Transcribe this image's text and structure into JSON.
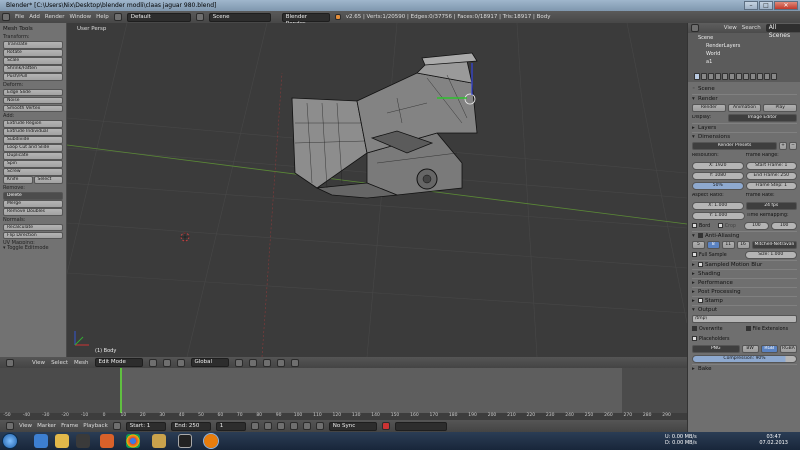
{
  "window": {
    "title": "Blender* [C:\\Users\\Nix\\Desktop\\blender modli\\claas jaguar 980.blend]",
    "minimize": "–",
    "maximize": "□",
    "close": "✕"
  },
  "infobar": {
    "menus": [
      "File",
      "Add",
      "Render",
      "Window",
      "Help"
    ],
    "screen_layout": "Default",
    "scene": "Scene",
    "engine": "Blender Render",
    "stats": "v2.65 | Verts:1/20590 | Edges:0/37756 | Faces:0/18917 | Tris:18917 | Body"
  },
  "toolpanel": {
    "title": "Mesh Tools",
    "sections": [
      {
        "label": "Transform:",
        "buttons": [
          "Translate",
          "Rotate",
          "Scale",
          "Shrink/Fatten",
          "Push/Pull"
        ]
      },
      {
        "label": "Deform:",
        "buttons": [
          "Edge Slide",
          "Noise",
          "Smooth Vertex"
        ]
      },
      {
        "label": "Add:",
        "buttons": [
          "Extrude Region",
          "Extrude Individual",
          "Subdivide",
          "Loop Cut and Slide",
          "Duplicate",
          "Spin",
          "Screw"
        ]
      }
    ],
    "knife_select": [
      "Knife",
      "Select"
    ],
    "remove_label": "Remove:",
    "remove_buttons": [
      "Delete",
      "Merge",
      "Remove Doubles"
    ],
    "normals_label": "Normals:",
    "normals_buttons": [
      "Recalculate",
      "Flip Direction"
    ],
    "uv_label": "UV Mapping:",
    "toggle_editmode": "Toggle Editmode"
  },
  "viewport": {
    "view_name": "User Persp",
    "object_label": "(1) Body"
  },
  "viewheader": {
    "items": [
      "View",
      "Select",
      "Mesh"
    ],
    "mode": "Edit Mode",
    "orientation": "Global"
  },
  "timeline": {
    "ticks": [
      "-50",
      "-40",
      "-30",
      "-20",
      "-10",
      "0",
      "10",
      "20",
      "30",
      "40",
      "50",
      "60",
      "70",
      "80",
      "90",
      "100",
      "110",
      "120",
      "130",
      "140",
      "150",
      "160",
      "170",
      "180",
      "190",
      "200",
      "210",
      "220",
      "230",
      "240",
      "250",
      "260",
      "270",
      "280",
      "290"
    ],
    "menus": [
      "View",
      "Marker",
      "Frame",
      "Playback"
    ],
    "start": "Start: 1",
    "end": "End: 250",
    "current": "1",
    "sync": "No Sync"
  },
  "outliner": {
    "menus": [
      "View",
      "Search"
    ],
    "scope": "All Scenes",
    "rows": [
      "Scene",
      "RenderLayers",
      "World",
      "a1"
    ]
  },
  "properties": {
    "breadcrumb": "Scene",
    "render_header": "Render",
    "render_buttons": [
      "Render",
      "Animation",
      "Play"
    ],
    "display_label": "Display:",
    "display_value": "Image Editor",
    "layers": "Layers",
    "dimensions": "Dimensions",
    "presets": "Render Presets",
    "resolution_label": "Resolution:",
    "frame_range_label": "Frame Range:",
    "res_x": "X: 1920",
    "res_y": "Y: 1080",
    "res_pct": "50%",
    "start_frame": "Start Frame: 1",
    "end_frame": "End Frame: 250",
    "frame_step": "Frame Step: 1",
    "aspect_label": "Aspect Ratio:",
    "frame_rate_label": "Frame Rate:",
    "aspect_x": "X: 1.000",
    "aspect_y": "Y: 1.000",
    "fps": "24 fps",
    "time_remap_label": "Time Remapping:",
    "remap_old": "100",
    "remap_new": "100",
    "border": "Bord",
    "crop": "Crop",
    "antialiasing": "Anti-Aliasing",
    "aa_samples": [
      "5",
      "8",
      "11",
      "16"
    ],
    "aa_filter": "Mitchell-Netravali",
    "full_sample": "Full Sample",
    "aa_size": "Size: 1.000",
    "collapsed": [
      "Sampled Motion Blur",
      "Shading",
      "Performance",
      "Post Processing",
      "Stamp"
    ],
    "output": "Output",
    "output_path": "/tmp\\",
    "overwrite": "Overwrite",
    "file_extensions": "File Extensions",
    "placeholders": "Placeholders",
    "format": "PNG",
    "color_modes": [
      "BW",
      "RGB",
      "RGBA"
    ],
    "compression": "Compression: 90%",
    "bake": "Bake"
  },
  "taskbar": {
    "net_up": "U:   0.00 MB/s",
    "net_down": "D:   0.00 MB/s",
    "time": "03:47",
    "date": "07.02.2013"
  }
}
